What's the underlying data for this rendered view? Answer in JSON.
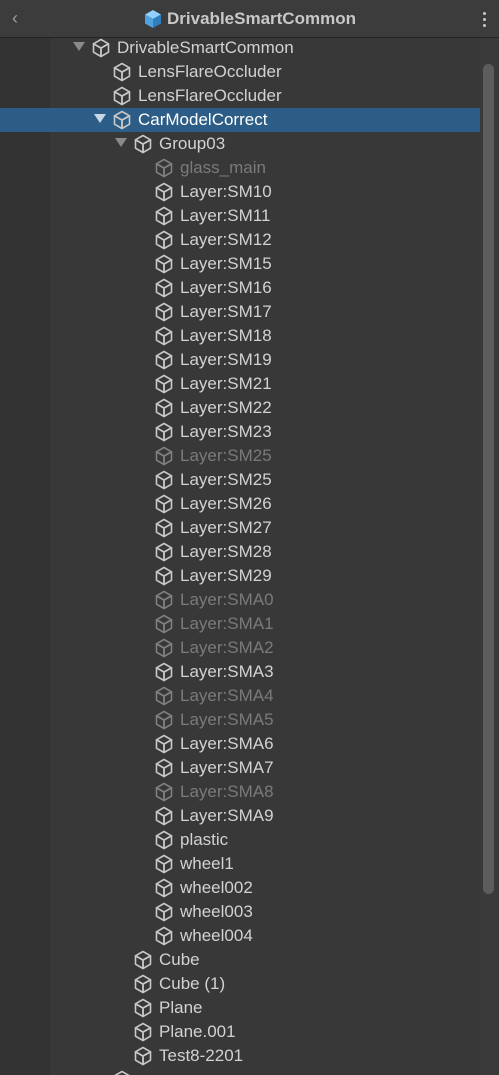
{
  "header": {
    "title": "DrivableSmartCommon",
    "back_icon": "chevron-left-icon",
    "menu_icon": "kebab-menu-icon",
    "prefab_icon_color": "#4fa3e0"
  },
  "colors": {
    "selected": "#2c5d87",
    "text": "#d2d2d2",
    "disabled_text": "#7a7a7a"
  },
  "tree": [
    {
      "label": "DrivableSmartCommon",
      "depth": 0,
      "expanded": true,
      "disabled": false,
      "selected": false
    },
    {
      "label": "LensFlareOccluder",
      "depth": 1,
      "expanded": null,
      "disabled": false,
      "selected": false
    },
    {
      "label": "LensFlareOccluder",
      "depth": 1,
      "expanded": null,
      "disabled": false,
      "selected": false
    },
    {
      "label": "CarModelCorrect",
      "depth": 1,
      "expanded": true,
      "disabled": false,
      "selected": true
    },
    {
      "label": "Group03",
      "depth": 2,
      "expanded": true,
      "disabled": false,
      "selected": false
    },
    {
      "label": "glass_main",
      "depth": 3,
      "expanded": null,
      "disabled": true,
      "selected": false
    },
    {
      "label": "Layer:SM10",
      "depth": 3,
      "expanded": null,
      "disabled": false,
      "selected": false
    },
    {
      "label": "Layer:SM11",
      "depth": 3,
      "expanded": null,
      "disabled": false,
      "selected": false
    },
    {
      "label": "Layer:SM12",
      "depth": 3,
      "expanded": null,
      "disabled": false,
      "selected": false
    },
    {
      "label": "Layer:SM15",
      "depth": 3,
      "expanded": null,
      "disabled": false,
      "selected": false
    },
    {
      "label": "Layer:SM16",
      "depth": 3,
      "expanded": null,
      "disabled": false,
      "selected": false
    },
    {
      "label": "Layer:SM17",
      "depth": 3,
      "expanded": null,
      "disabled": false,
      "selected": false
    },
    {
      "label": "Layer:SM18",
      "depth": 3,
      "expanded": null,
      "disabled": false,
      "selected": false
    },
    {
      "label": "Layer:SM19",
      "depth": 3,
      "expanded": null,
      "disabled": false,
      "selected": false
    },
    {
      "label": "Layer:SM21",
      "depth": 3,
      "expanded": null,
      "disabled": false,
      "selected": false
    },
    {
      "label": "Layer:SM22",
      "depth": 3,
      "expanded": null,
      "disabled": false,
      "selected": false
    },
    {
      "label": "Layer:SM23",
      "depth": 3,
      "expanded": null,
      "disabled": false,
      "selected": false
    },
    {
      "label": "Layer:SM25",
      "depth": 3,
      "expanded": null,
      "disabled": true,
      "selected": false
    },
    {
      "label": "Layer:SM25",
      "depth": 3,
      "expanded": null,
      "disabled": false,
      "selected": false
    },
    {
      "label": "Layer:SM26",
      "depth": 3,
      "expanded": null,
      "disabled": false,
      "selected": false
    },
    {
      "label": "Layer:SM27",
      "depth": 3,
      "expanded": null,
      "disabled": false,
      "selected": false
    },
    {
      "label": "Layer:SM28",
      "depth": 3,
      "expanded": null,
      "disabled": false,
      "selected": false
    },
    {
      "label": "Layer:SM29",
      "depth": 3,
      "expanded": null,
      "disabled": false,
      "selected": false
    },
    {
      "label": "Layer:SMA0",
      "depth": 3,
      "expanded": null,
      "disabled": true,
      "selected": false
    },
    {
      "label": "Layer:SMA1",
      "depth": 3,
      "expanded": null,
      "disabled": true,
      "selected": false
    },
    {
      "label": "Layer:SMA2",
      "depth": 3,
      "expanded": null,
      "disabled": true,
      "selected": false
    },
    {
      "label": "Layer:SMA3",
      "depth": 3,
      "expanded": null,
      "disabled": false,
      "selected": false
    },
    {
      "label": "Layer:SMA4",
      "depth": 3,
      "expanded": null,
      "disabled": true,
      "selected": false
    },
    {
      "label": "Layer:SMA5",
      "depth": 3,
      "expanded": null,
      "disabled": true,
      "selected": false
    },
    {
      "label": "Layer:SMA6",
      "depth": 3,
      "expanded": null,
      "disabled": false,
      "selected": false
    },
    {
      "label": "Layer:SMA7",
      "depth": 3,
      "expanded": null,
      "disabled": false,
      "selected": false
    },
    {
      "label": "Layer:SMA8",
      "depth": 3,
      "expanded": null,
      "disabled": true,
      "selected": false
    },
    {
      "label": "Layer:SMA9",
      "depth": 3,
      "expanded": null,
      "disabled": false,
      "selected": false
    },
    {
      "label": "plastic",
      "depth": 3,
      "expanded": null,
      "disabled": false,
      "selected": false
    },
    {
      "label": "wheel1",
      "depth": 3,
      "expanded": null,
      "disabled": false,
      "selected": false
    },
    {
      "label": "wheel002",
      "depth": 3,
      "expanded": null,
      "disabled": false,
      "selected": false
    },
    {
      "label": "wheel003",
      "depth": 3,
      "expanded": null,
      "disabled": false,
      "selected": false
    },
    {
      "label": "wheel004",
      "depth": 3,
      "expanded": null,
      "disabled": false,
      "selected": false
    },
    {
      "label": "Cube",
      "depth": 2,
      "expanded": null,
      "disabled": false,
      "selected": false
    },
    {
      "label": "Cube (1)",
      "depth": 2,
      "expanded": null,
      "disabled": false,
      "selected": false
    },
    {
      "label": "Plane",
      "depth": 2,
      "expanded": null,
      "disabled": false,
      "selected": false
    },
    {
      "label": "Plane.001",
      "depth": 2,
      "expanded": null,
      "disabled": false,
      "selected": false
    },
    {
      "label": "Test8-2201",
      "depth": 2,
      "expanded": null,
      "disabled": false,
      "selected": false
    },
    {
      "label": "",
      "depth": 1,
      "expanded": null,
      "disabled": false,
      "selected": false
    }
  ]
}
